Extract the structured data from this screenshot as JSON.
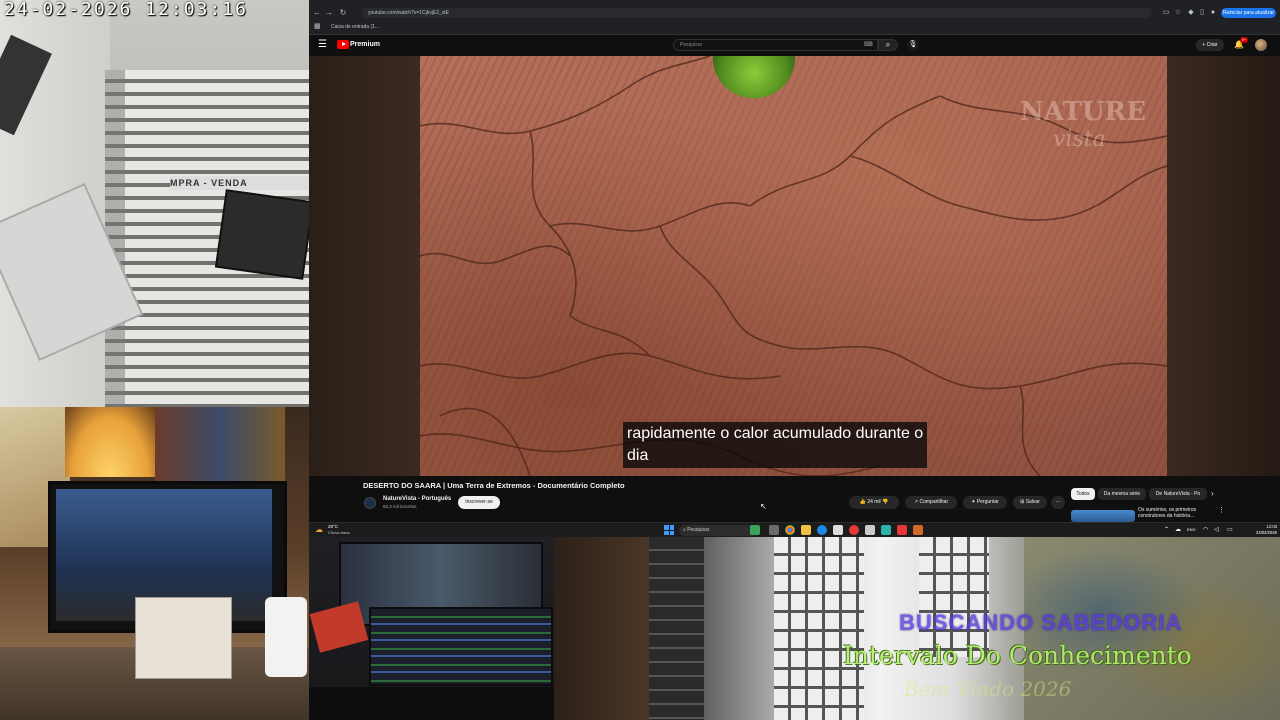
{
  "camera": {
    "timestamp": "24-02-2026  12:03:16",
    "sign_text": "MPRA - VENDA"
  },
  "browser": {
    "url": "youtube.com/watch?v=1CjkvjE2_vtE",
    "update_button": "Reiniciar para atualizar",
    "bookmark": "Caixa de entrada (1..."
  },
  "youtube": {
    "brand": "Premium",
    "search_placeholder": "Pesquisar",
    "create_label": "+ Criar",
    "notifications": "9+",
    "video": {
      "watermark_line1": "NATURE",
      "watermark_line2": "vista",
      "caption_line1": "rapidamente o calor acumulado durante o",
      "caption_line2": "dia",
      "title": "DESERTO DO SAARA | Uma Terra de Extremos - Documentário Completo"
    },
    "channel": {
      "name": "NatureVista - Português",
      "subscribers": "60,3 mil inscritos",
      "subscribe_label": "Inscrever-se"
    },
    "actions": {
      "likes": "24 mil",
      "share": "Compartilhar",
      "ask": "Perguntar",
      "save": "Salvar",
      "more": "···"
    },
    "chips": [
      "Todos",
      "Da mesma série",
      "De NatureVista - Po"
    ],
    "recommendation": {
      "title": "Os sumérios, os primeiros construtores da história..."
    }
  },
  "taskbar": {
    "weather_temp": "29°C",
    "weather_desc": "Chuva fraca",
    "search_placeholder": "Pesquisar",
    "lang": "ENG",
    "time": "12:03",
    "date": "24/02/2026"
  },
  "overlay": {
    "line1": "BUSCANDO SABEDORIA",
    "line2": "Intervalo Do Conhecimento",
    "line3": "Bem Vindo 2026"
  },
  "colors": {
    "youtube_red": "#ff0000",
    "overlay_purple": "#5a3ae0",
    "overlay_green": "#b8f070",
    "update_blue": "#1a73e8"
  }
}
